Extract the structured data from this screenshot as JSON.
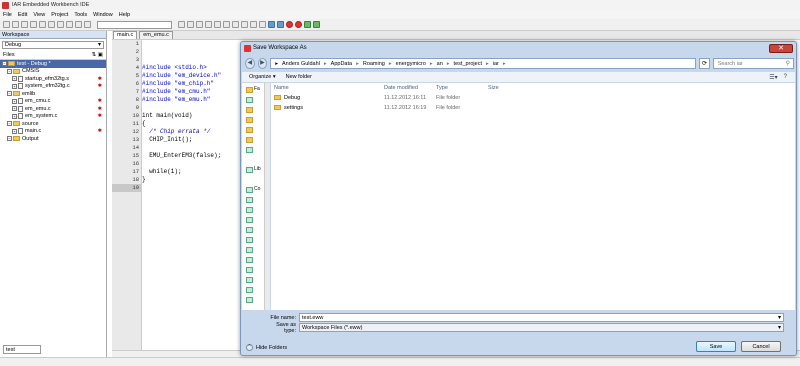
{
  "ide": {
    "title": "IAR Embedded Workbench IDE",
    "menu": [
      "File",
      "Edit",
      "View",
      "Project",
      "Tools",
      "Window",
      "Help"
    ]
  },
  "workspace": {
    "header": "Workspace",
    "config": "Debug",
    "files_label": "Files",
    "tree": [
      {
        "label": "test - Debug *",
        "level": 0,
        "kind": "project",
        "selected": true
      },
      {
        "label": "CMSIS",
        "level": 1,
        "kind": "folder"
      },
      {
        "label": "startup_efm32tg.s",
        "level": 2,
        "kind": "file",
        "mark": true
      },
      {
        "label": "system_efm32tg.c",
        "level": 2,
        "kind": "file",
        "mark": true
      },
      {
        "label": "emlib",
        "level": 1,
        "kind": "folder"
      },
      {
        "label": "em_cmu.c",
        "level": 2,
        "kind": "file",
        "mark": true
      },
      {
        "label": "em_emu.c",
        "level": 2,
        "kind": "file",
        "mark": true
      },
      {
        "label": "em_system.c",
        "level": 2,
        "kind": "file",
        "mark": true
      },
      {
        "label": "source",
        "level": 1,
        "kind": "folder"
      },
      {
        "label": "main.c",
        "level": 2,
        "kind": "file",
        "mark": true
      },
      {
        "label": "Output",
        "level": 1,
        "kind": "folder"
      }
    ],
    "bottom_tab": "test"
  },
  "editor": {
    "tabs": [
      "main.c",
      "em_emu.c"
    ],
    "line_numbers": [
      "1",
      "2",
      "3",
      "4",
      "5",
      "6",
      "7",
      "8",
      "9",
      "10",
      "11",
      "12",
      "13",
      "14",
      "15",
      "16",
      "17",
      "18",
      "19"
    ],
    "highlight_line": 19,
    "code": [
      "",
      "",
      "",
      "#include <stdio.h>",
      "#include \"em_device.h\"",
      "#include \"em_chip.h\"",
      "#include \"em_cmu.h\"",
      "#include \"em_emu.h\"",
      "",
      "int main(void)",
      "{",
      "  /* Chip errata */",
      "  CHIP_Init();",
      "",
      "  EMU_EnterEM3(false);",
      "",
      "  while(1);",
      "}",
      ""
    ]
  },
  "dialog": {
    "title": "Save Workspace As",
    "close": "✕",
    "path": [
      "Anders Guldahl",
      "AppData",
      "Roaming",
      "energymicro",
      "an",
      "test_project",
      "iar"
    ],
    "search_placeholder": "Search iar",
    "organize": "Organize ▾",
    "new_folder": "New folder",
    "nav_labels": [
      "Fa",
      "Lib",
      "Co"
    ],
    "columns": [
      "Name",
      "Date modified",
      "Type",
      "Size"
    ],
    "files": [
      {
        "name": "Debug",
        "date": "11.12.2012 16:11",
        "type": "File folder",
        "size": ""
      },
      {
        "name": "settings",
        "date": "11.12.2012 16:19",
        "type": "File folder",
        "size": ""
      }
    ],
    "file_name_label": "File name:",
    "file_name": "test.eww",
    "save_type_label": "Save as type:",
    "save_type": "Workspace Files (*.eww)",
    "hide_folders": "Hide Folders",
    "save_btn": "Save",
    "cancel_btn": "Cancel"
  }
}
